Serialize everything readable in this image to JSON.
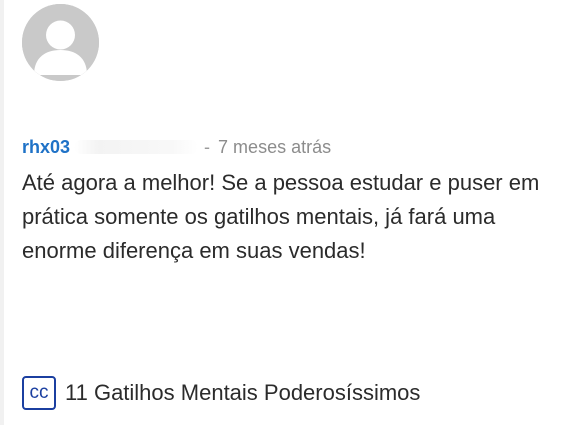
{
  "comment": {
    "avatar_icon": "default-user-icon",
    "username": "rhx03",
    "separator": "-",
    "time_ago": "7 meses atrás",
    "text": "Até agora a melhor! Se a pessoa estudar e puser em prática somente os gatilhos mentais, já fará uma enorme diferença em suas vendas!"
  },
  "course": {
    "badge_label": "CC",
    "title": "11 Gatilhos Mentais Poderosíssimos"
  },
  "colors": {
    "username": "#1f72c7",
    "badge": "#1b3fa0",
    "avatar_bg": "#c9c9c9",
    "avatar_fg": "#ffffff"
  }
}
